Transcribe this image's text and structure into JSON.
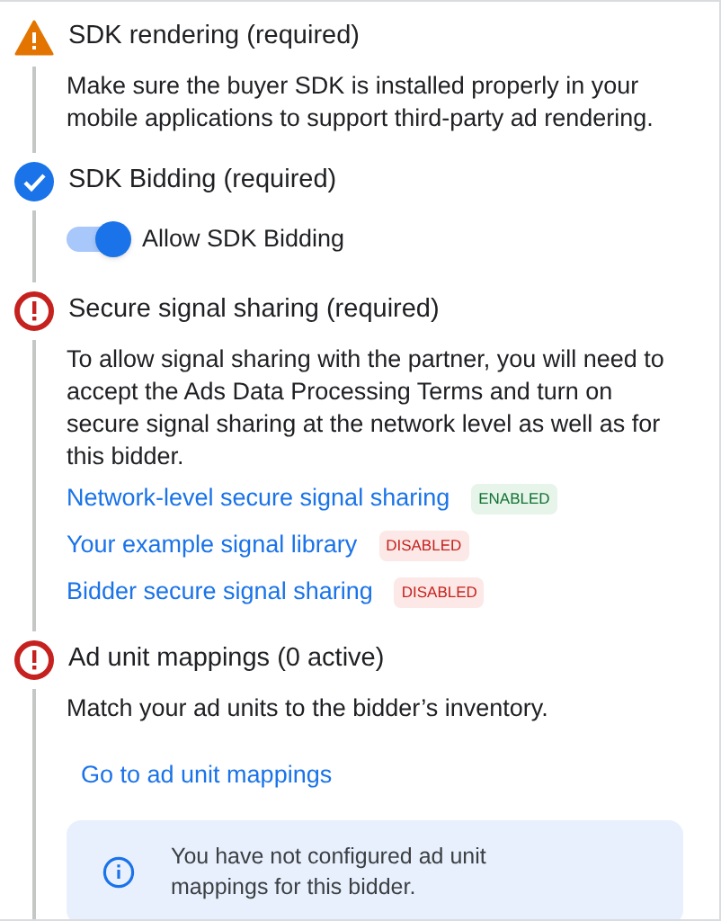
{
  "steps": [
    {
      "kind": "warning",
      "title": "SDK rendering (required)",
      "body": [
        {
          "kind": "paragraph",
          "text": "Make sure the buyer SDK is installed properly in your mobile applications to support third-party ad rendering."
        }
      ]
    },
    {
      "kind": "done",
      "title": "SDK Bidding (required)",
      "body": [
        {
          "kind": "toggle",
          "label": "Allow SDK Bidding",
          "on": true
        }
      ]
    },
    {
      "kind": "error",
      "title": "Secure signal sharing (required)",
      "body": [
        {
          "kind": "paragraph",
          "text": "To allow signal sharing with the partner, you will need to accept the Ads Data Processing Terms and turn on secure signal sharing at the network level as well as for this bidder."
        },
        {
          "kind": "status_link",
          "text": "Network-level secure signal sharing",
          "badge": "ENABLED",
          "enabled": true
        },
        {
          "kind": "status_link",
          "text": "Your example signal library",
          "badge": "DISABLED",
          "enabled": false
        },
        {
          "kind": "status_link",
          "text": "Bidder secure signal sharing",
          "badge": "DISABLED",
          "enabled": false
        }
      ]
    },
    {
      "kind": "error",
      "title": "Ad unit mappings (0 active)",
      "body": [
        {
          "kind": "paragraph",
          "text": "Match your ad units to the bidder’s inventory."
        },
        {
          "kind": "link",
          "text": "Go to ad unit mappings"
        },
        {
          "kind": "info",
          "text": "You have not configured ad unit mappings for this bidder."
        }
      ]
    }
  ]
}
